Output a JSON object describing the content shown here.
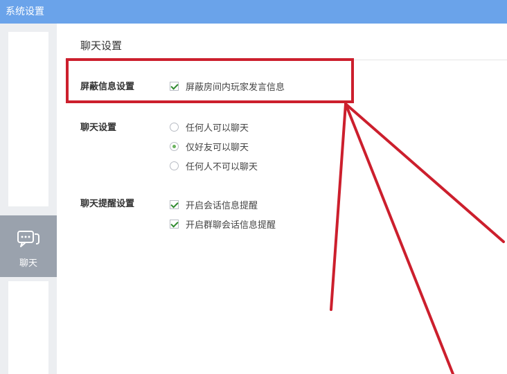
{
  "window": {
    "title": "系统设置"
  },
  "sidebar": {
    "chat_label": "聊天",
    "chat_icon": "chat-bubble-icon"
  },
  "main": {
    "title": "聊天设置",
    "sections": [
      {
        "label": "屏蔽信息设置",
        "options": [
          {
            "type": "checkbox",
            "label": "屏蔽房间内玩家发言信息",
            "checked": true
          }
        ]
      },
      {
        "label": "聊天设置",
        "options": [
          {
            "type": "radio",
            "label": "任何人可以聊天",
            "checked": false
          },
          {
            "type": "radio",
            "label": "仅好友可以聊天",
            "checked": true
          },
          {
            "type": "radio",
            "label": "任何人不可以聊天",
            "checked": false
          }
        ]
      },
      {
        "label": "聊天提醒设置",
        "options": [
          {
            "type": "checkbox",
            "label": "开启会话信息提醒",
            "checked": true
          },
          {
            "type": "checkbox",
            "label": "开启群聊会话信息提醒",
            "checked": true
          }
        ]
      }
    ]
  },
  "annotation": {
    "color": "#cc1f2d"
  }
}
